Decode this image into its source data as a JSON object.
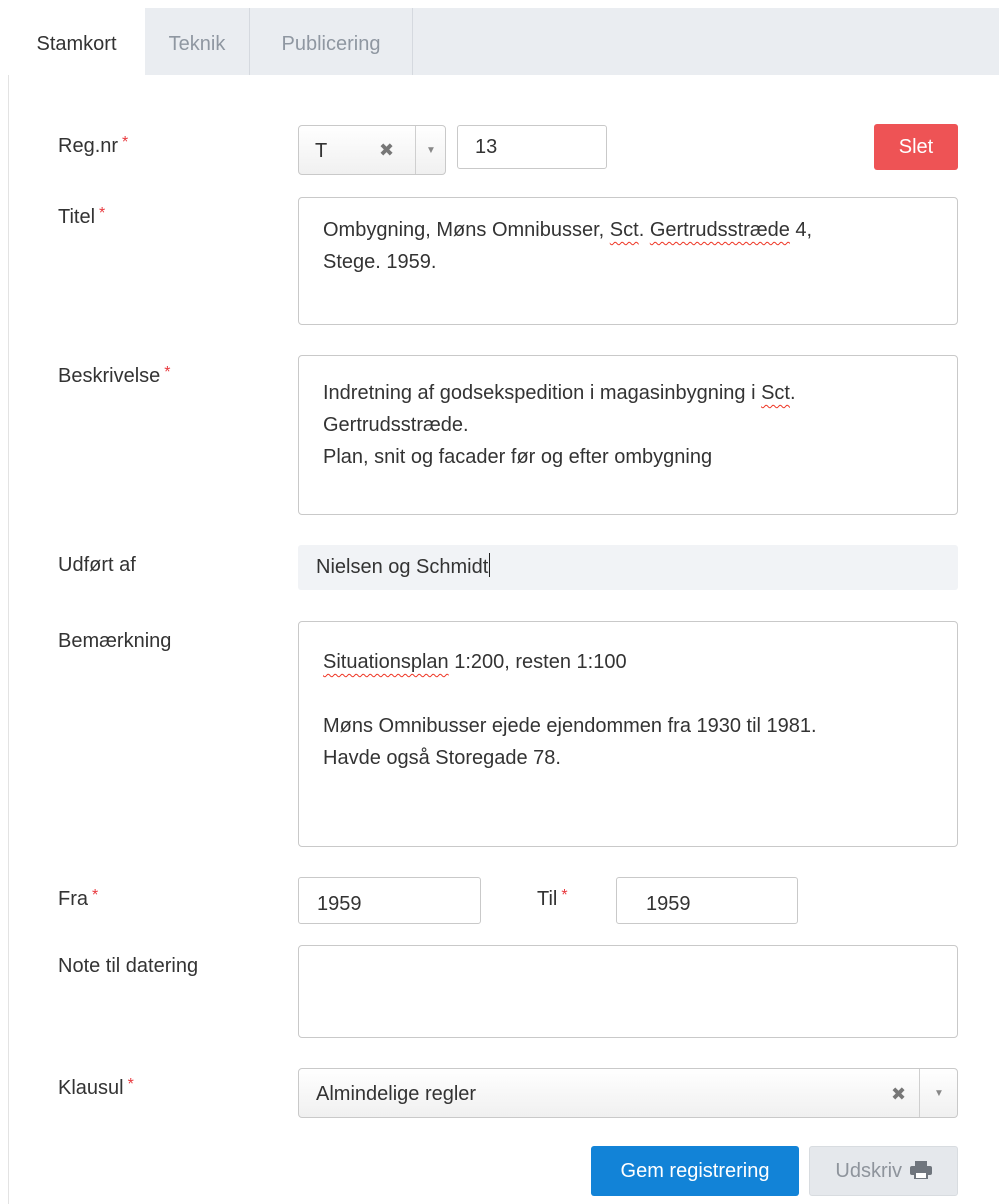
{
  "tabs": [
    {
      "label": "Stamkort",
      "active": true
    },
    {
      "label": "Teknik",
      "active": false
    },
    {
      "label": "Publicering",
      "active": false
    }
  ],
  "required_marker": "*",
  "form": {
    "regnr": {
      "label": "Reg.nr",
      "prefix_value": "T",
      "number_value": "13"
    },
    "delete_label": "Slet",
    "titel": {
      "label": "Titel",
      "lines": [
        "Ombygning, Møns Omnibusser, Sct. Gertrudsstræde 4,",
        "Stege. 1959."
      ]
    },
    "beskrivelse": {
      "label": "Beskrivelse",
      "lines": [
        "Indretning af godsekspedition i magasinbygning i Sct.",
        "Gertrudsstræde.",
        "Plan, snit og facader før og efter ombygning"
      ]
    },
    "udfoert_af": {
      "label": "Udført af",
      "value": "Nielsen og Schmidt"
    },
    "bemaerkning": {
      "label": "Bemærkning",
      "lines": [
        "Situationsplan 1:200, resten 1:100",
        "",
        "Møns Omnibusser ejede ejendommen fra 1930 til 1981.",
        "Havde også Storegade 78."
      ]
    },
    "fra": {
      "label": "Fra",
      "value": "1959"
    },
    "til": {
      "label": "Til",
      "value": "1959"
    },
    "note_datering": {
      "label": "Note til datering",
      "value": ""
    },
    "klausul": {
      "label": "Klausul",
      "value": "Almindelige regler"
    }
  },
  "actions": {
    "save_label": "Gem registrering",
    "print_label": "Udskriv"
  },
  "icons": {
    "clear": "clear-x-icon",
    "dropdown": "dropdown-arrow-icon",
    "print": "printer-icon"
  },
  "colors": {
    "required": "#e8383d",
    "danger": "#ee5355",
    "primary": "#1283d7"
  }
}
